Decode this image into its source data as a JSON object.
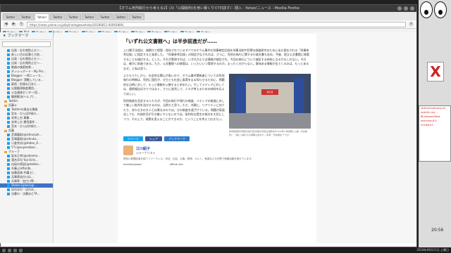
{
  "window": {
    "title": "【オウム死刑執行から考える2】(3)「公開版利)を用い暴くり!(7日誌す) - 閲入 - Yahoo!ニュース - Mozilla Firefox"
  },
  "tabs": [
    "Twitter",
    "Twitter",
    "Yahoo!",
    "Twitter",
    "Twitter",
    "Twitter",
    "Twitter",
    "Twitter",
    "Twitter"
  ],
  "bookmarks": [
    "Twitter",
    "再び",
    "Twitter",
    "Twitter",
    "Twitter",
    "Twitter",
    "Twitter",
    "Twitter",
    "Twitter",
    "Twitter",
    "Twitter",
    "Twitter",
    "Twitter"
  ],
  "url": "https://news.yahoo.co.jp/byline/egawashoko/20180811-00093806/",
  "sidebar": {
    "title": "ブックマーク",
    "items": [
      {
        "label": "出発・忘れ物防止セン…",
        "kind": "item"
      },
      {
        "label": "新しい古の記事と大地…",
        "kind": "item"
      },
      {
        "label": "出発・忘れ物防止セン…",
        "kind": "item"
      },
      {
        "label": "出発・忘れ物防止セン…",
        "kind": "item"
      },
      {
        "label": "歌曲の検索結果…",
        "kind": "item"
      },
      {
        "label": "ダッシュボード - My Pro…",
        "kind": "item"
      },
      {
        "label": "Blogger: 一閃ニュース…",
        "kind": "item"
      },
      {
        "label": "Blogger: 潜動している…",
        "kind": "item"
      },
      {
        "label": "豪雨・危険な日本と…",
        "kind": "item"
      },
      {
        "label": "災害観測制度運用…",
        "kind": "item"
      },
      {
        "label": "公告連絡センター(気…",
        "kind": "item"
      },
      {
        "label": "鍵便解決(ヘルプ)…",
        "kind": "item"
      },
      {
        "label": "Twitter",
        "kind": "folder"
      },
      {
        "label": "呉藤エ",
        "kind": "folder"
      },
      {
        "label": "Twitterの過去な情報",
        "kind": "item"
      },
      {
        "label": "宮本・ひらば作新た…",
        "kind": "item"
      },
      {
        "label": "非常上台 事書…",
        "kind": "item"
      },
      {
        "label": "非常上台 運用連件…",
        "kind": "item"
      },
      {
        "label": "宮本・ひらば作新た…",
        "kind": "item"
      },
      {
        "label": "呉藤",
        "kind": "folder"
      },
      {
        "label": "宮澤嘉助(@ishiunjoh…",
        "kind": "item"
      },
      {
        "label": "宮澤嘉助(@ishiuka…",
        "kind": "item"
      },
      {
        "label": "小倉秀夫(@Hideo_O…",
        "kind": "item"
      },
      {
        "label": "Y.T.(@vuyanobox…",
        "kind": "item"
      },
      {
        "label": "グループ",
        "kind": "folder"
      },
      {
        "label": "坂本正幸(@sakamo…",
        "kind": "item"
      },
      {
        "label": "落合洋司 Yoji Ochi…",
        "kind": "item"
      },
      {
        "label": "自殺の原因(@dakkio…",
        "kind": "item"
      },
      {
        "label": "木藤土(kfta(海…",
        "kind": "item"
      },
      {
        "label": "加藤英雄 弁護士(…",
        "kind": "item"
      },
      {
        "label": "兵庫県加古川は…",
        "kind": "item"
      },
      {
        "label": "兵庫県・加古川警…",
        "kind": "item"
      },
      {
        "label": "Shoko Egawa(@…",
        "kind": "item"
      },
      {
        "label": "ほのぼの・ほのぼ…",
        "kind": "item"
      },
      {
        "label": "法曹の・法曹ほどTA…",
        "kind": "item"
      }
    ]
  },
  "article": {
    "heading": "「いずれ公文書館へ」は半歩前進だが……",
    "para1": "上川陽子法相は、検察庁で保管・保存されているすべてのオウム事件の刑事確定記録を刑事法制や犯罪の調査研究のために永久保存される「刑事参考記録」に指定すると発表した。「刑事参考記録」の指定がなされれば、さらに、死刑の執行に関する行政文書も含め、今後、国立公文書館に移管することを検討する。とした。それが実現すれば、いずれかよりは情報が検討され、今回の執行について検証する材料になるかもしれない。それは、確かに前進である。ただ、公文書館への移管は、いったいいつ実現するのか。まったく分からない。意味ある情報が出てくるのは、もっとあるなぜ。と私は思う。",
    "para2": "よりもう少しから、社会的な関心が高いので、オウム事件関係者についての死刑執行の時期は、死刑に国民が、ぜひとも社会に真実をまま知らせるために、問題的な当時に対して、もっと情報を公開すると求めたい。そしてメディアに対しては、連続報告ばかりではなく、さらに批判して、人々が考えるための材料を伝えてほしい。",
    "para3": "死刑制度を否定する人たちが、今回の執行や現行の制度、メディアの報道に対して厳しい批判を浴びせるのは、当然だと思う。ただ、冷静に、リアリティに欠けたり、合わせ方の大人とは異なるのでは。方の制度を遠ざけている。問題が表面化しても、外部状況が引き継いでいないのでは。批判的な提言の視点を大切にしつつ、その上で、現実を変えることができるか、ということを考えておきたい。",
    "caption": "東京拘置所の刑場の執行室(内部の写真は法務省が2010年に報道陣に公開、代表撮影)。一般に公開される時期も含まれ…(写真：代表撮影/アフロ)",
    "sign": "執行室",
    "share": [
      "ツイート",
      "シェア",
      "ブックマーク"
    ],
    "author_name": "江川紹子",
    "author_role": "ジャーナリスト",
    "bio": "神奈川新聞記者を経てフリーランス。司法、社会、災害、教育、カルト、音楽などの分野で執筆活動を続けています。",
    "foot_left": "ameblo/egawa",
    "foot_right": "official site"
  },
  "side_widgets": {
    "term_lines": [
      "/add-sh/upd-xorg.sh",
      "/add-fin-/n/r...",
      "Bluenosan/Bhot",
      "esumjnw-8.0",
      "2018/8/11"
    ],
    "xlogo": "X",
    "clock": "20:56"
  },
  "taskbar": {
    "clock_date": "2018年08月11日 土曜日"
  }
}
